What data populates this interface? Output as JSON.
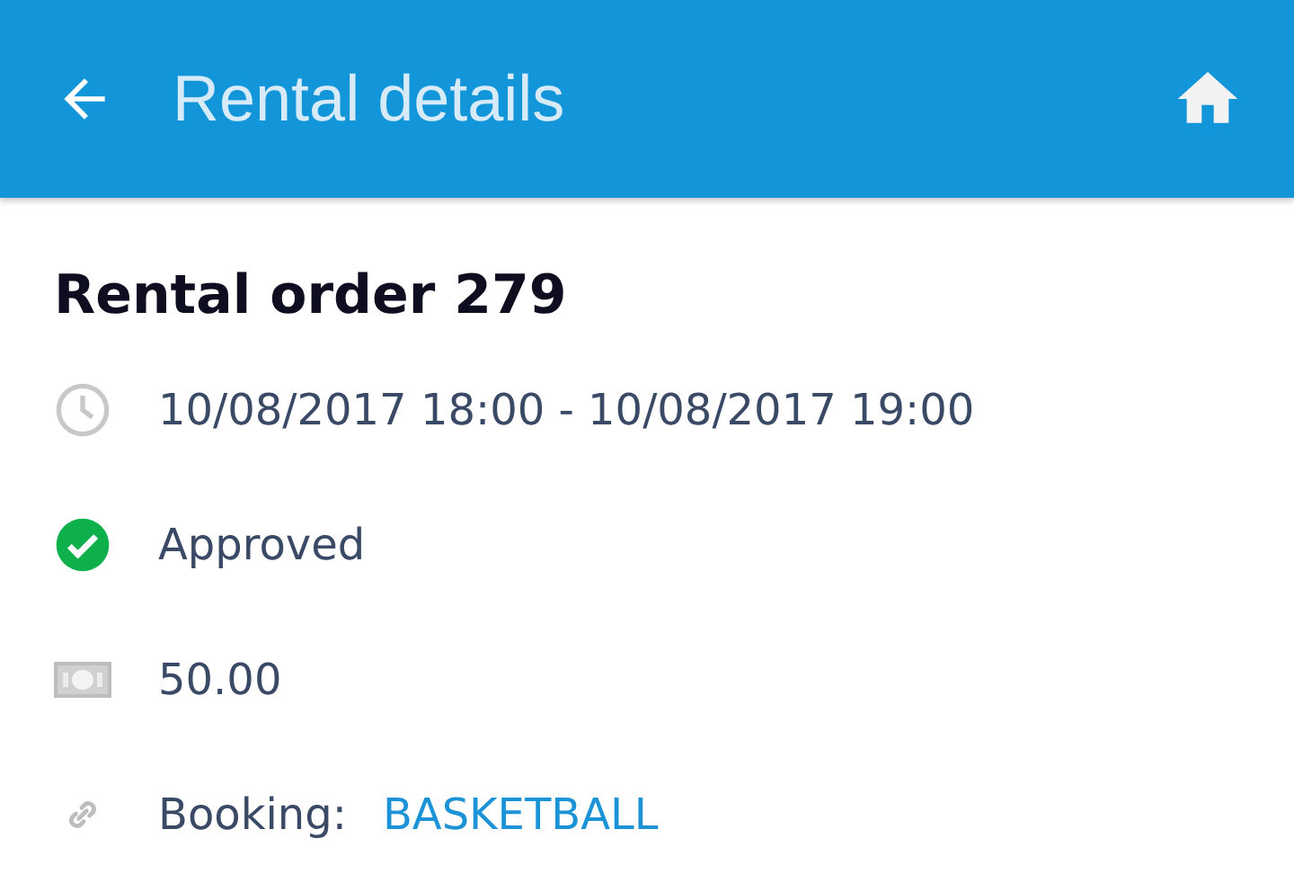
{
  "app_bar": {
    "title": "Rental details"
  },
  "order": {
    "title": "Rental order 279",
    "rows": [
      {
        "kind": "time",
        "text": "10/08/2017 18:00 - 10/08/2017 19:00"
      },
      {
        "kind": "status",
        "text": "Approved"
      },
      {
        "kind": "price",
        "text": "50.00"
      },
      {
        "kind": "link",
        "label": "Booking:",
        "link": "BASKETBALL"
      }
    ]
  }
}
